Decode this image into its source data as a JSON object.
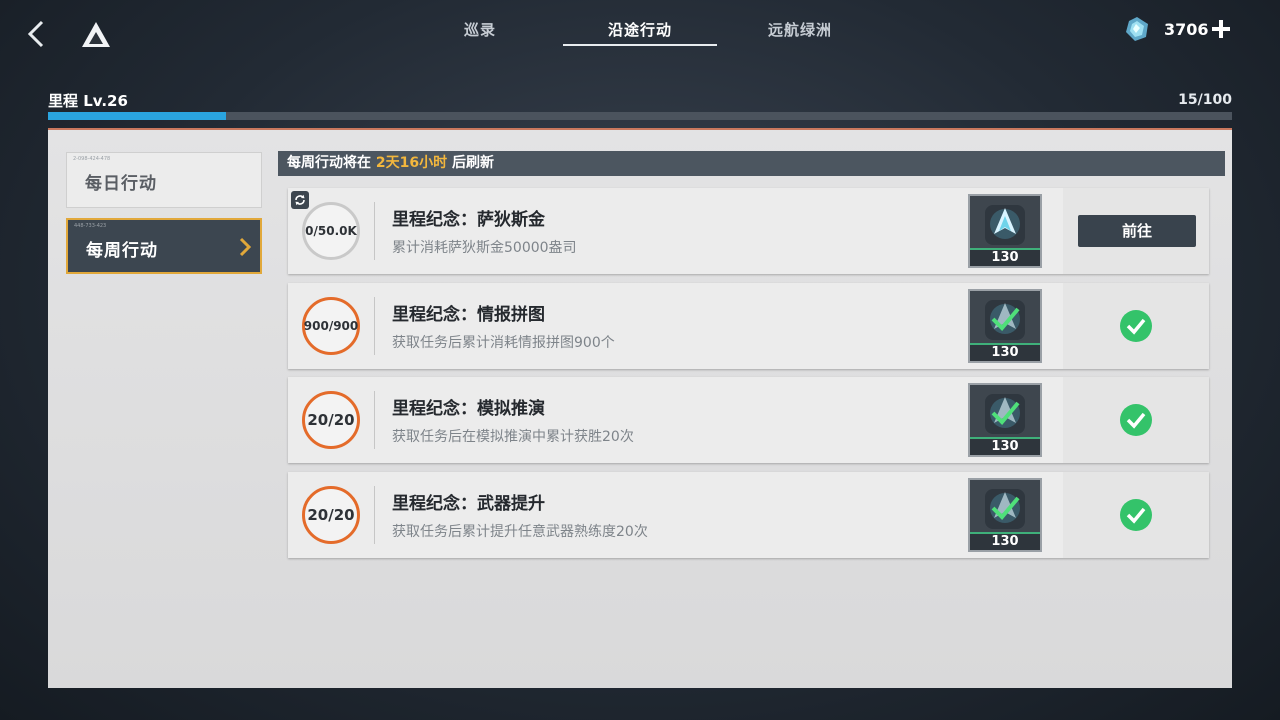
{
  "tabs": [
    "巡录",
    "沿途行动",
    "远航绿洲"
  ],
  "active_tab": "沿途行动",
  "currency": {
    "icon": "crystal-icon",
    "value": "3706"
  },
  "level": {
    "title": "里程 Lv.26",
    "progress_text": "15/100",
    "progress": 0.15
  },
  "sidebar": {
    "daily": {
      "code": "2-098-424-478",
      "label": "每日行动"
    },
    "weekly": {
      "code": "448-733-423",
      "label": "每周行动"
    }
  },
  "header": {
    "prefix": "每周行动将在 ",
    "highlight": "2天16小时",
    "suffix": " 后刷新"
  },
  "tasks": [
    {
      "progress": "0/50.0K",
      "title": "里程纪念：萨狄斯金",
      "desc": "累计消耗萨狄斯金50000盎司",
      "reward_qty": "130",
      "action": "前往",
      "completed": false
    },
    {
      "progress": "900/900",
      "title": "里程纪念：情报拼图",
      "desc": "获取任务后累计消耗情报拼图900个",
      "reward_qty": "130",
      "action": "",
      "completed": true
    },
    {
      "progress": "20/20",
      "title": "里程纪念：模拟推演",
      "desc": "获取任务后在模拟推演中累计获胜20次",
      "reward_qty": "130",
      "action": "",
      "completed": true
    },
    {
      "progress": "20/20",
      "title": "里程纪念：武器提升",
      "desc": "获取任务后累计提升任意武器熟练度20次",
      "reward_qty": "130",
      "action": "",
      "completed": true
    }
  ],
  "colors": {
    "accent_blue": "#2aa4df",
    "highlight_yellow": "#f3b73d",
    "ring_orange": "#e46b2a",
    "check_green": "#34c36a"
  }
}
